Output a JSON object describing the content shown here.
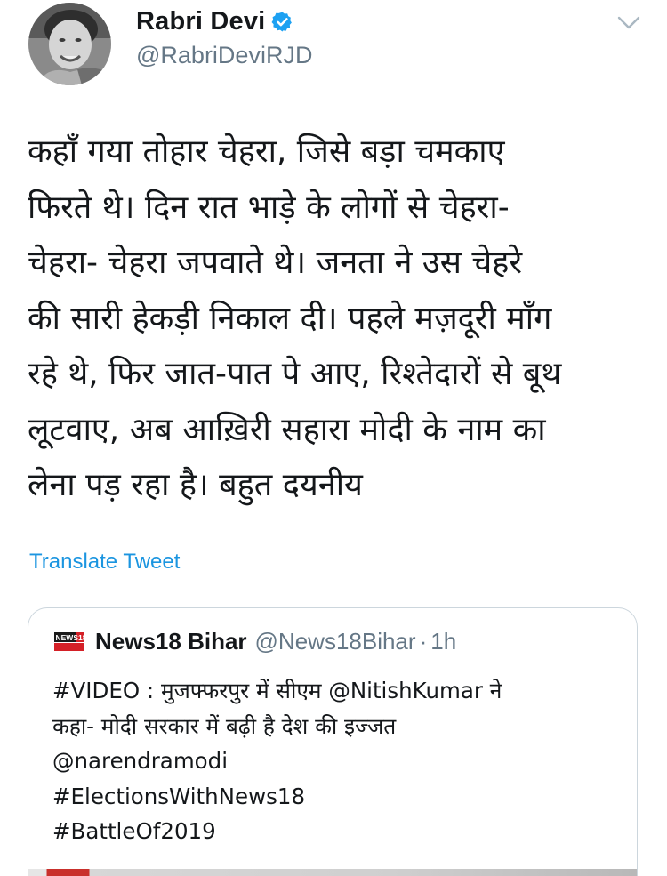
{
  "author": {
    "display_name": "Rabri Devi",
    "handle": "@RabriDeviRJD",
    "verified": true,
    "avatar_icon": "profile-photo",
    "menu_icon": "chevron-down-icon"
  },
  "tweet": {
    "lines": [
      "कहाँ गया तोहार चेहरा,  जिसे बड़ा चमकाए",
      "फिरते थे। दिन रात भाड़े के लोगों से चेहरा-",
      "चेहरा- चेहरा जपवाते थे। जनता ने उस चेहरे",
      "की सारी हेकड़ी निकाल दी। पहले मज़दूरी माँग",
      "रहे थे, फिर जात-पात पे आए, रिश्तेदारों से बूथ",
      "लूटवाए, अब आख़िरी सहारा मोदी के नाम का",
      "लेना पड़ रहा है। बहुत दयनीय"
    ],
    "translate_label": "Translate Tweet"
  },
  "quoted_tweet": {
    "logo_text": "NEWS18",
    "display_name": "News18 Bihar",
    "handle": "@News18Bihar",
    "separator": "·",
    "time": "1h",
    "lines": [
      "#VIDEO : मुजफ्फरपुर में सीएम @NitishKumar ने",
      "कहा- मोदी सरकार में बढ़ी है देश की इज्जत",
      "@narendramodi",
      "#ElectionsWithNews18",
      "#BattleOf2019"
    ]
  },
  "colors": {
    "text": "#14171a",
    "secondary": "#657786",
    "link": "#1b95e0",
    "verified": "#1da1f2",
    "border": "#ccd6dd"
  }
}
